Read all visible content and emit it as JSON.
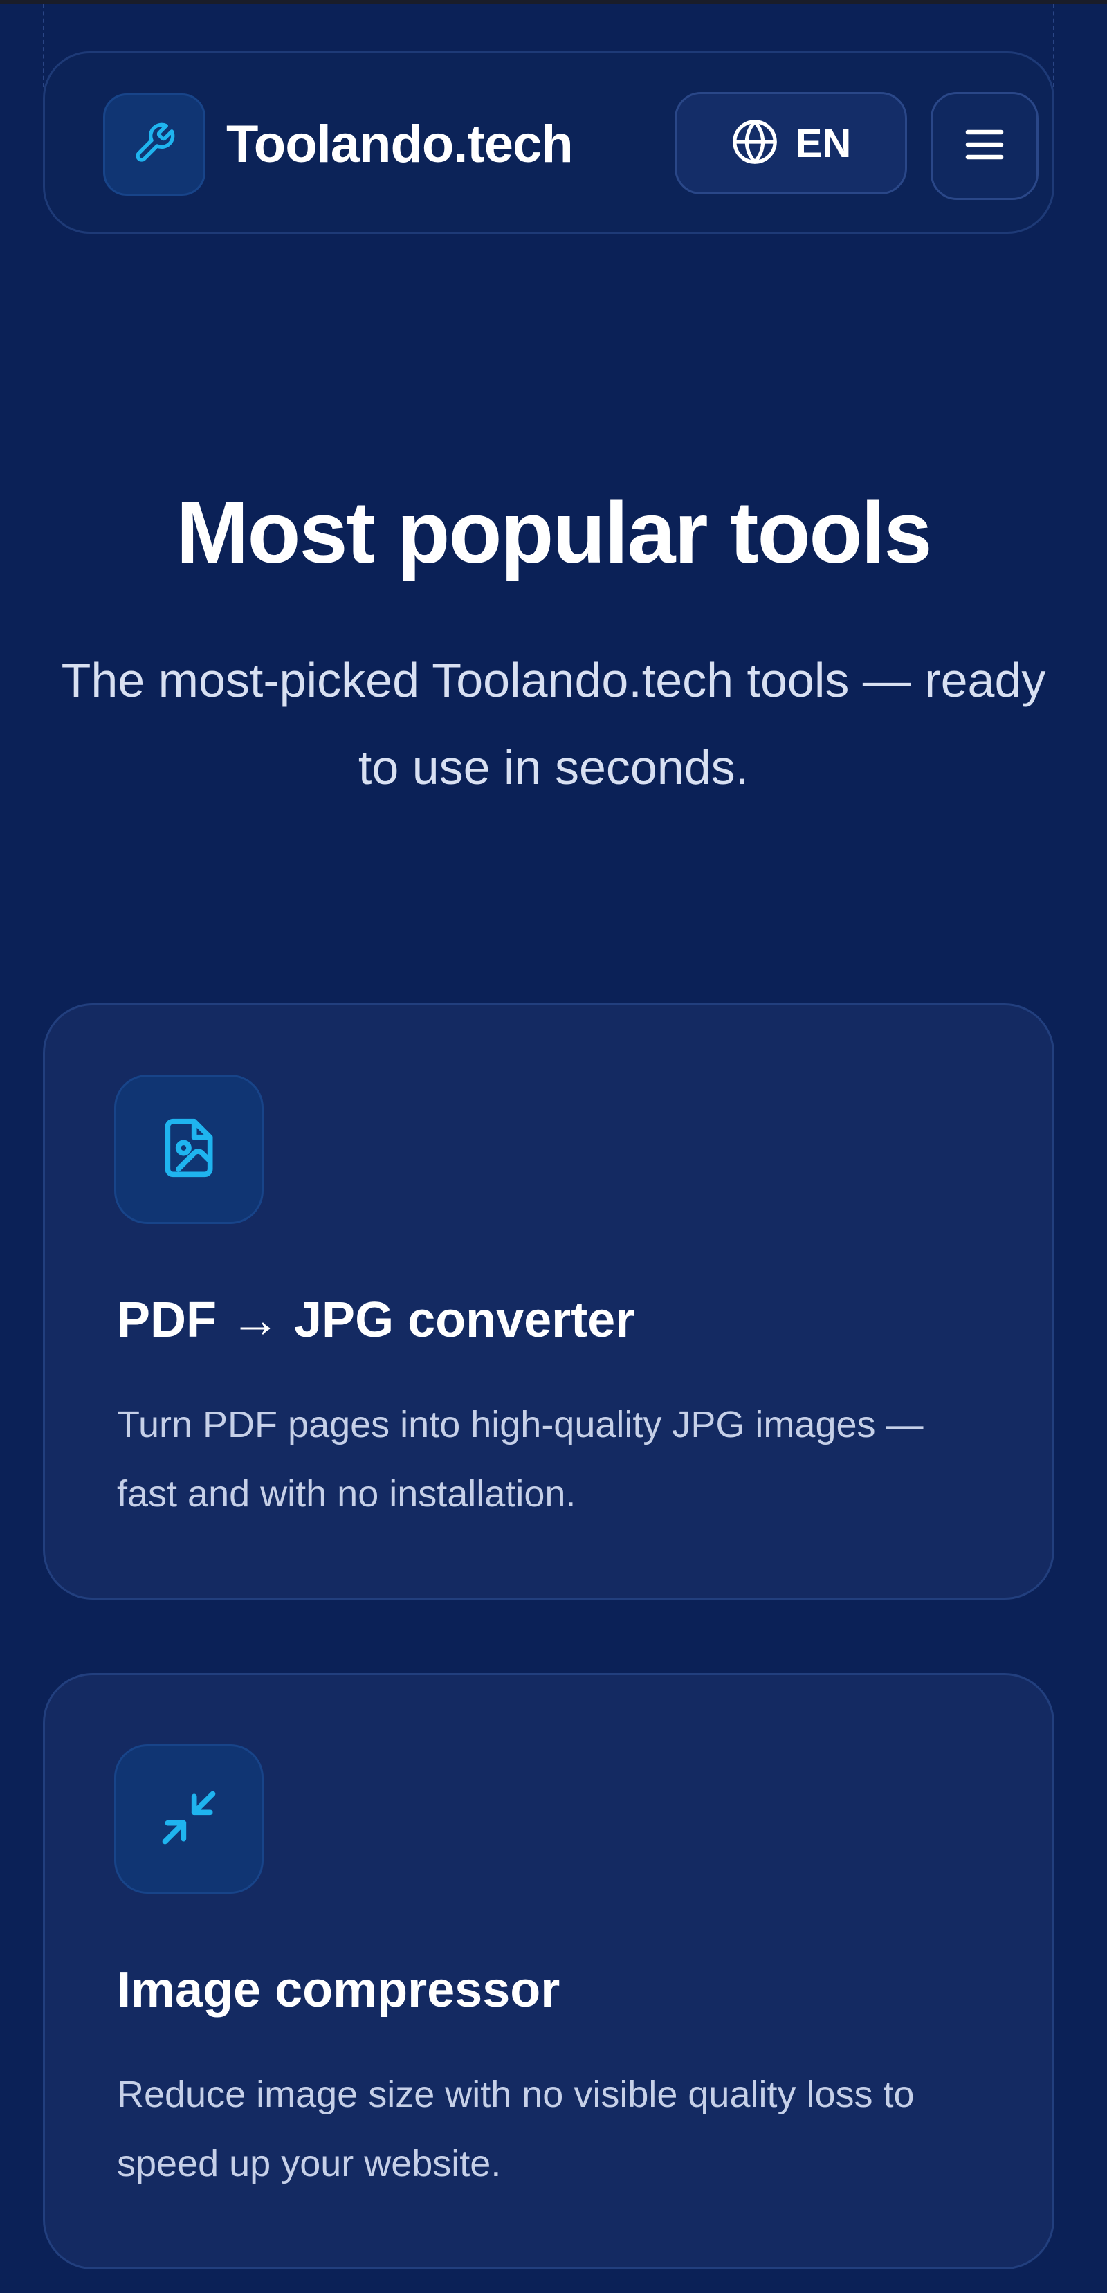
{
  "header": {
    "brand": "Toolando.tech",
    "language": "EN",
    "logo_icon": "wrench-icon",
    "language_icon": "globe-icon",
    "menu_icon": "hamburger-menu-icon"
  },
  "hero": {
    "title": "Most popular tools",
    "subtitle": "The most-picked Toolando.tech tools — ready to use in seconds."
  },
  "tools": [
    {
      "icon": "file-image-icon",
      "title": "PDF → JPG converter",
      "description": "Turn PDF pages into high-quality JPG images — fast and with no installation."
    },
    {
      "icon": "compress-arrows-icon",
      "title": "Image compressor",
      "description": "Reduce image size with no visible quality loss to speed up your website."
    }
  ],
  "colors": {
    "background": "#0b2157",
    "card": "#142a62",
    "accent": "#1fb4ef",
    "text": "#ffffff",
    "muted_text": "#c6d0e8"
  }
}
